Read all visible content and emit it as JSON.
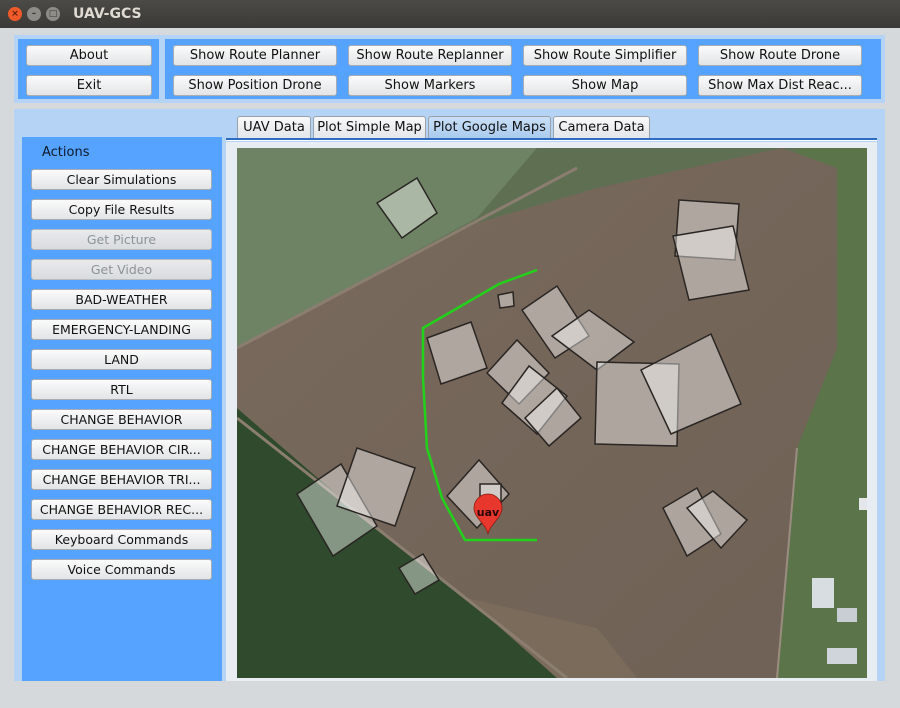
{
  "window": {
    "title": "UAV-GCS",
    "controls": {
      "close_icon": "×",
      "minimize_icon": "–",
      "maximize_icon": "□"
    }
  },
  "top_buttons": {
    "left": [
      "About",
      "Exit"
    ],
    "right_row1": [
      "Show Route Planner",
      "Show Route Replanner",
      "Show Route Simplifier",
      "Show Route Drone"
    ],
    "right_row2": [
      "Show Position Drone",
      "Show Markers",
      "Show Map",
      "Show Max Dist Reac..."
    ]
  },
  "sidebar": {
    "title": "Actions",
    "buttons": [
      {
        "label": "Clear Simulations",
        "enabled": true
      },
      {
        "label": "Copy File Results",
        "enabled": true
      },
      {
        "label": "Get Picture",
        "enabled": false
      },
      {
        "label": "Get Video",
        "enabled": false
      },
      {
        "label": "BAD-WEATHER",
        "enabled": true
      },
      {
        "label": "EMERGENCY-LANDING",
        "enabled": true
      },
      {
        "label": "LAND",
        "enabled": true
      },
      {
        "label": "RTL",
        "enabled": true
      },
      {
        "label": "CHANGE BEHAVIOR",
        "enabled": true
      },
      {
        "label": "CHANGE BEHAVIOR CIR...",
        "enabled": true
      },
      {
        "label": "CHANGE BEHAVIOR TRI...",
        "enabled": true
      },
      {
        "label": "CHANGE BEHAVIOR REC...",
        "enabled": true
      },
      {
        "label": "Keyboard Commands",
        "enabled": true
      },
      {
        "label": "Voice Commands",
        "enabled": true
      }
    ]
  },
  "tabs": [
    {
      "label": "UAV Data",
      "active": false
    },
    {
      "label": "Plot Simple Map",
      "active": false
    },
    {
      "label": "Plot Google Maps",
      "active": true
    },
    {
      "label": "Camera Data",
      "active": false
    }
  ],
  "map": {
    "marker_label": "uav",
    "route_color": "#22d11a",
    "marker_color": "#e8372c",
    "obstacle_color": "#ffffff"
  }
}
